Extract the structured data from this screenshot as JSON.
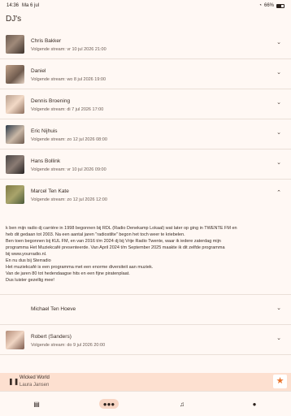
{
  "status": {
    "time": "14:36",
    "date": "Ma 6 jul",
    "battery": "66%"
  },
  "title": "DJ's",
  "djs": [
    {
      "name": "Chris Bakker",
      "next": "Volgende stream: vr 10 jul 2026 21:00"
    },
    {
      "name": "Daniel",
      "next": "Volgende stream: wo 8 jul 2026 19:00"
    },
    {
      "name": "Dennis Broening",
      "next": "Volgende stream: di 7 jul 2026 17:00"
    },
    {
      "name": "Eric Nijhuis",
      "next": "Volgende stream: zo 12 jul 2026 08:00"
    },
    {
      "name": "Hans Bollink",
      "next": "Volgende stream: vr 10 jul 2026 09:00"
    },
    {
      "name": "Marcel Ten Kate",
      "next": "Volgende stream: zo 12 jul 2026 12:00",
      "bio": "k ben mijn radio dj carrière in 1998 begonnen bij RDL (Radio Denekamp Lokaal) wat later op ging in TWENTE FM en\nheb dit gedaan tot 2003. Na een aantal jaren \"radiostilte\" begon het toch weer te kriebelen.\nBen toen begonnen bij KUL FM, en van 2016 t/m 2024 dj bij Vrije Radio Twente, waar ik  iedere zaterdag mijn\nprogramma Het Muziekcafé presenteerde. Van April 2024 t/m September 2025 maakte ik dit zelfde programma\nbij www.yourradio.nl.\nEn nu dus bij Sterradio\nHet muziekcafé is een programma met een enorme diversiteit aan muziek.\nVan de jaren 80 tot hedendaagse hits en een fijne piratenplaat.\nDus luister gezellig mee!"
    },
    {
      "name": "Michael Ten Hoeve",
      "next": ""
    },
    {
      "name": "Robert (Sanders)",
      "next": "Volgende stream: do 9 jul 2026 20:00"
    }
  ],
  "player": {
    "title": "Wicked World",
    "artist": "Laura Jansen"
  },
  "nav": [
    "news-icon",
    "people-icon",
    "music-icon",
    "person-icon"
  ]
}
